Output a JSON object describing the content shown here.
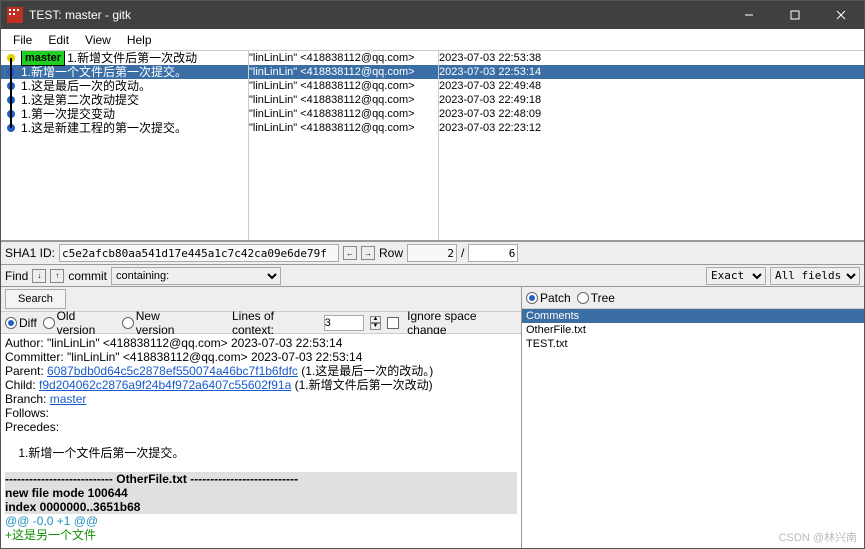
{
  "window": {
    "title": "TEST: master - gitk"
  },
  "menu": {
    "file": "File",
    "edit": "Edit",
    "view": "View",
    "help": "Help"
  },
  "commits": [
    {
      "branch": "master",
      "subject": "1.新增文件后第一次改动",
      "author": "\"linLinLin\" <418838112@qq.com>",
      "date": "2023-07-03 22:53:38",
      "selected": false,
      "head": true,
      "dot": "yellow"
    },
    {
      "subject": "1.新增一个文件后第一次提交。",
      "author": "\"linLinLin\" <418838112@qq.com>",
      "date": "2023-07-03 22:53:14",
      "selected": true,
      "dot": "blue"
    },
    {
      "subject": "1.这是最后一次的改动。",
      "author": "\"linLinLin\" <418838112@qq.com>",
      "date": "2023-07-03 22:49:48",
      "selected": false,
      "dot": "blue"
    },
    {
      "subject": "1.这是第二次改动提交",
      "author": "\"linLinLin\" <418838112@qq.com>",
      "date": "2023-07-03 22:49:18",
      "selected": false,
      "dot": "blue"
    },
    {
      "subject": "1.第一次提交变动",
      "author": "\"linLinLin\" <418838112@qq.com>",
      "date": "2023-07-03 22:48:09",
      "selected": false,
      "dot": "blue"
    },
    {
      "subject": "1.这是新建工程的第一次提交。",
      "author": "\"linLinLin\" <418838112@qq.com>",
      "date": "2023-07-03 22:23:12",
      "selected": false,
      "dot": "blue"
    }
  ],
  "sha": {
    "label": "SHA1 ID:",
    "value": "c5e2afcb80aa541d17e445a1c7c42ca09e6de79f",
    "row_label": "Row",
    "row": "2",
    "sep": "/",
    "total": "6"
  },
  "find": {
    "label": "Find",
    "mode": "commit",
    "op": "containing:",
    "match": "Exact",
    "fields": "All fields"
  },
  "detail_toolbar": {
    "search": "Search",
    "diff": "Diff",
    "old": "Old version",
    "new": "New version",
    "loc_label": "Lines of context:",
    "loc": "3",
    "ignore": "Ignore space change"
  },
  "detail": {
    "author_line": "Author: \"linLinLin\" <418838112@qq.com>  2023-07-03 22:53:14",
    "committer_line": "Committer: \"linLinLin\" <418838112@qq.com>  2023-07-03 22:53:14",
    "parent_label": "Parent: ",
    "parent_hash": "6087bdb0d64c5c2878ef550074a46bc7f1b6fdfc",
    "parent_desc": " (1.这是最后一次的改动。)",
    "child_label": "Child:  ",
    "child_hash": "f9d204062c2876a9f24b4f972a6407c55602f91a",
    "child_desc": " (1.新增文件后第一次改动)",
    "branch_label": "Branch: ",
    "branch_link": "master",
    "follows": "Follows:",
    "precedes": "Precedes:",
    "commit_msg": "    1.新增一个文件后第一次提交。",
    "sep": "--------------------------- OtherFile.txt ---------------------------",
    "mode": "new file mode 100644",
    "index": "index 0000000..3651b68",
    "hunk": "@@ -0,0 +1 @@",
    "add": "+这是另一个文件"
  },
  "tree_toolbar": {
    "patch": "Patch",
    "tree": "Tree"
  },
  "tree": {
    "items": [
      "Comments",
      "OtherFile.txt",
      "TEST.txt"
    ],
    "selected": 0
  },
  "watermark": "CSDN @林兴南"
}
